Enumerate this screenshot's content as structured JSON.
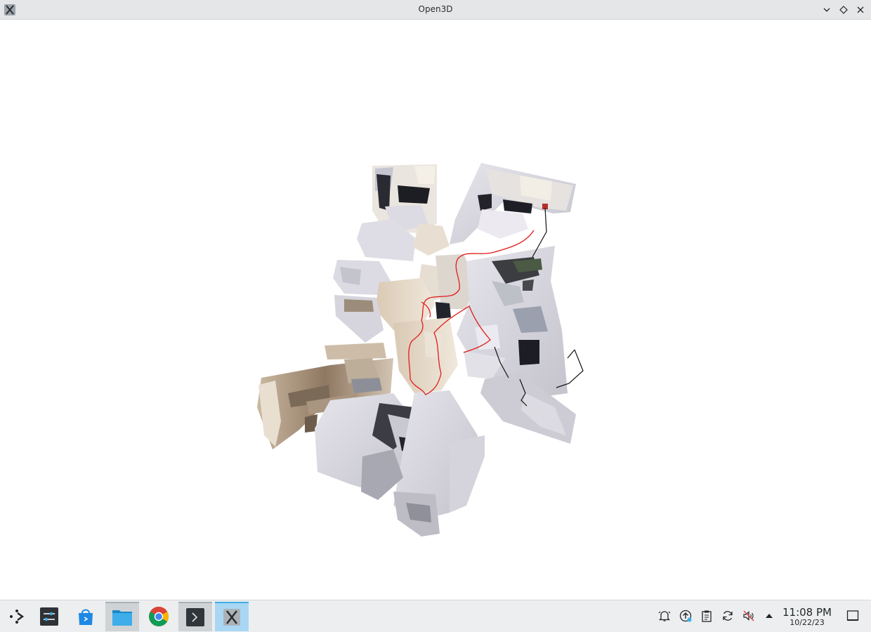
{
  "window": {
    "title": "Open3D",
    "app_icon": "x11-app-icon",
    "controls": [
      "minimize-icon",
      "maximize-icon",
      "close-icon"
    ]
  },
  "viewport": {
    "background": "#ffffff",
    "trajectory_color": "#e21b1b",
    "camera_line_color": "#111111"
  },
  "taskbar": {
    "items": [
      {
        "name": "application-launcher",
        "icon": "kde-launcher-icon"
      },
      {
        "name": "system-settings",
        "icon": "settings-sliders-icon"
      },
      {
        "name": "discover",
        "icon": "store-bag-icon"
      },
      {
        "name": "file-manager",
        "icon": "folder-icon"
      },
      {
        "name": "chrome",
        "icon": "chrome-icon"
      },
      {
        "name": "terminal",
        "icon": "terminal-icon"
      },
      {
        "name": "open3d-window",
        "icon": "x11-app-icon"
      }
    ],
    "tray": [
      "notifications-icon",
      "updates-icon",
      "clipboard-icon",
      "sync-icon",
      "volume-muted-icon",
      "expand-tray-icon"
    ],
    "clock": {
      "time": "11:08 PM",
      "date": "10/22/23"
    }
  }
}
